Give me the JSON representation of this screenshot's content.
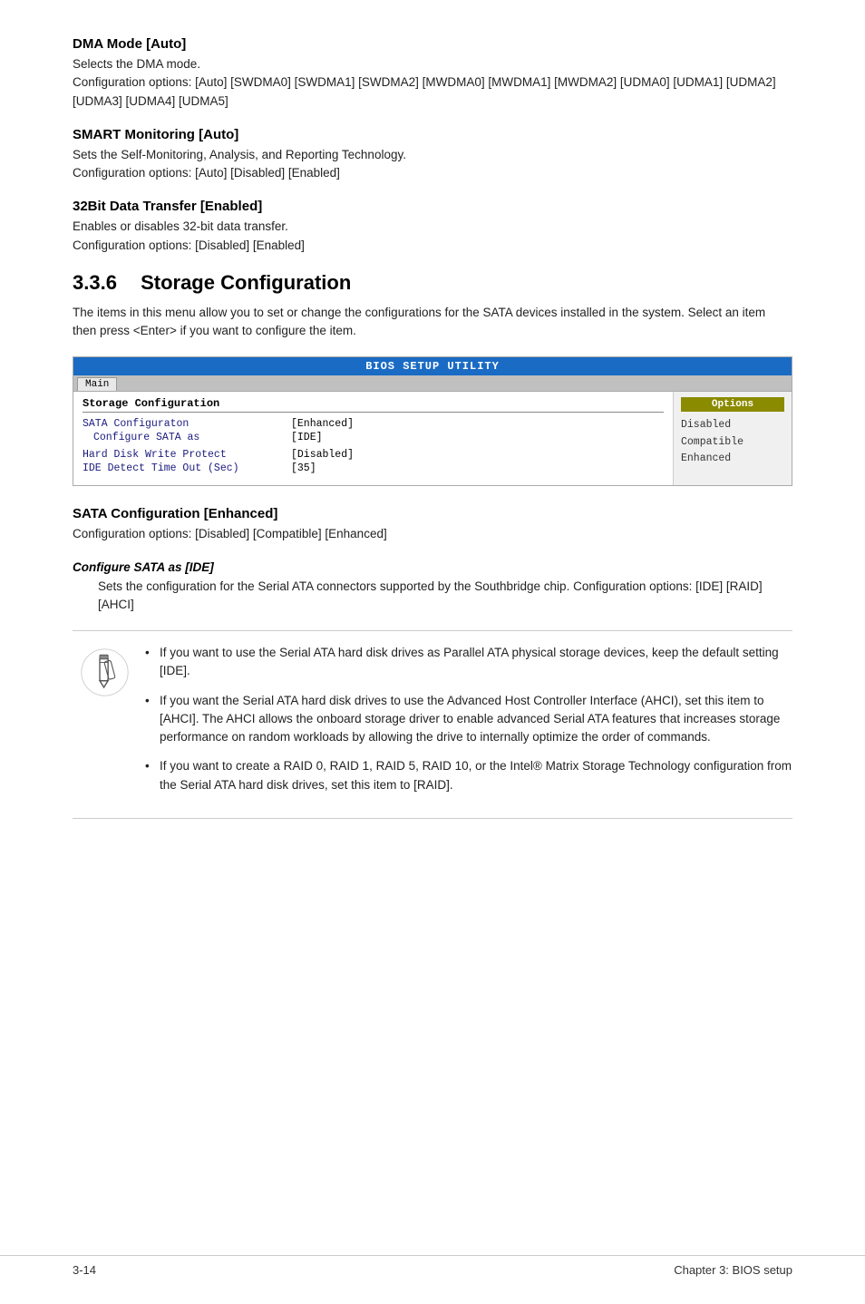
{
  "dma_mode": {
    "heading": "DMA Mode [Auto]",
    "description": "Selects the DMA mode.",
    "config_options": "Configuration options: [Auto] [SWDMA0] [SWDMA1] [SWDMA2] [MWDMA0] [MWDMA1] [MWDMA2] [UDMA0] [UDMA1] [UDMA2] [UDMA3] [UDMA4] [UDMA5]"
  },
  "smart_monitoring": {
    "heading": "SMART Monitoring [Auto]",
    "description": "Sets the Self-Monitoring, Analysis, and Reporting Technology.",
    "config_options": "Configuration options: [Auto] [Disabled] [Enabled]"
  },
  "bit_data_transfer": {
    "heading": "32Bit Data Transfer [Enabled]",
    "description": "Enables or disables 32-bit data transfer.",
    "config_options": "Configuration options: [Disabled] [Enabled]"
  },
  "storage_config_section": {
    "number": "3.3.6",
    "title": "Storage Configuration",
    "intro": "The items in this menu allow you to set or change the configurations for the SATA devices installed in the system. Select an item then press <Enter> if you want to configure the item."
  },
  "bios_ui": {
    "title": "BIOS SETUP UTILITY",
    "tab": "Main",
    "section_title": "Storage Configuration",
    "options_title": "Options",
    "rows": [
      {
        "label": "SATA Configuraton",
        "value": "[Enhanced]",
        "indent": false
      },
      {
        "label": "Configure SATA as",
        "value": "[IDE]",
        "indent": true
      },
      {
        "label": "Hard Disk Write Protect",
        "value": "[Disabled]",
        "indent": false
      },
      {
        "label": "IDE Detect Time Out (Sec)",
        "value": "[35]",
        "indent": false
      }
    ],
    "sidebar_options": [
      "Disabled",
      "Compatible",
      "Enhanced"
    ]
  },
  "sata_config": {
    "heading": "SATA Configuration [Enhanced]",
    "config_options": "Configuration options: [Disabled] [Compatible] [Enhanced]",
    "subsection_label": "Configure SATA as [IDE]",
    "subsection_body": "Sets the configuration for the Serial ATA connectors supported by the Southbridge chip. Configuration options: [IDE] [RAID] [AHCI]"
  },
  "notes": [
    "If you want to use the Serial ATA hard disk drives as Parallel ATA physical storage devices, keep the default setting [IDE].",
    "If you want the Serial ATA hard disk drives to use the Advanced Host Controller Interface (AHCI), set this item to [AHCI]. The AHCI allows the onboard storage driver to enable advanced Serial ATA features that increases storage performance on random workloads by allowing the drive to internally optimize the order of commands.",
    "If you want to create a RAID 0, RAID 1, RAID 5, RAID 10, or the Intel® Matrix Storage Technology configuration from the Serial ATA hard disk drives, set this item to [RAID]."
  ],
  "footer": {
    "page": "3-14",
    "chapter": "Chapter 3: BIOS setup"
  }
}
